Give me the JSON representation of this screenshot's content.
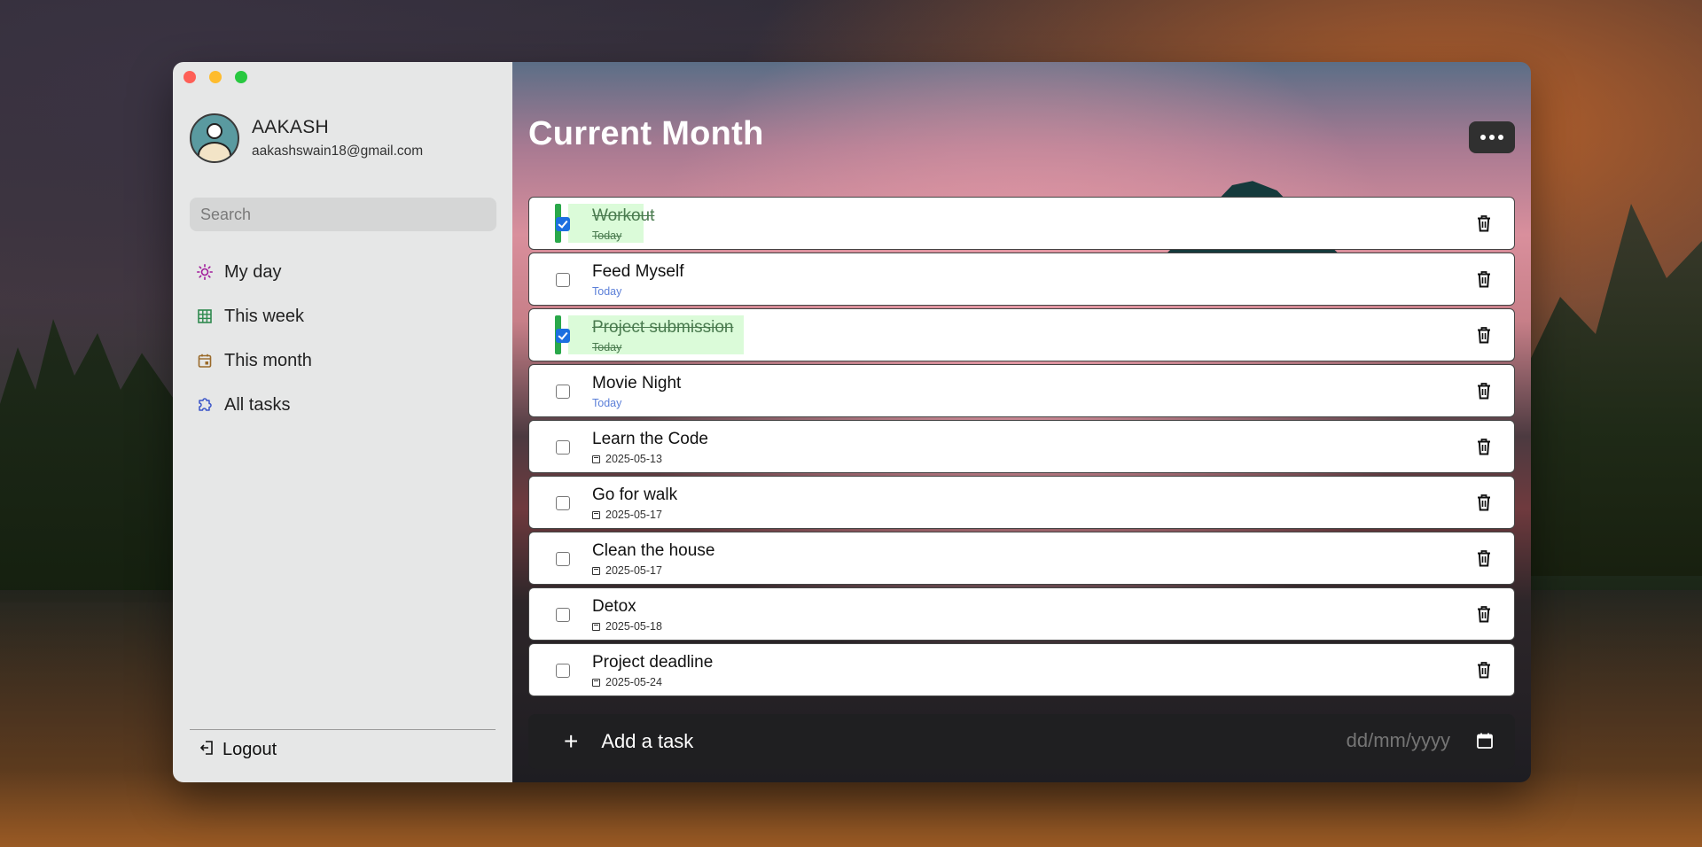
{
  "window": {
    "traffic_lights": [
      "close",
      "minimize",
      "maximize"
    ]
  },
  "sidebar": {
    "profile": {
      "name": "AAKASH",
      "email": "aakashswain18@gmail.com",
      "avatar_icon": "user-avatar-icon"
    },
    "search": {
      "placeholder": "Search",
      "value": ""
    },
    "nav": [
      {
        "label": "My day",
        "icon": "sun-icon",
        "color": "#a11b9a"
      },
      {
        "label": "This week",
        "icon": "grid-icon",
        "color": "#2f8a4f"
      },
      {
        "label": "This month",
        "icon": "calendar-icon",
        "color": "#9a6a2a"
      },
      {
        "label": "All tasks",
        "icon": "puzzle-icon",
        "color": "#3a55c9"
      }
    ],
    "logout_label": "Logout"
  },
  "main": {
    "title": "Current Month",
    "more_icon": "ellipsis-icon",
    "tasks": [
      {
        "title": "Workout",
        "meta": "Today",
        "meta_type": "today",
        "done": true
      },
      {
        "title": "Feed Myself",
        "meta": "Today",
        "meta_type": "today",
        "done": false
      },
      {
        "title": "Project submission",
        "meta": "Today",
        "meta_type": "today",
        "done": true
      },
      {
        "title": "Movie Night",
        "meta": "Today",
        "meta_type": "today",
        "done": false
      },
      {
        "title": "Learn the Code",
        "meta": "2025-05-13",
        "meta_type": "date",
        "done": false
      },
      {
        "title": "Go for walk",
        "meta": "2025-05-17",
        "meta_type": "date",
        "done": false
      },
      {
        "title": "Clean the house",
        "meta": "2025-05-17",
        "meta_type": "date",
        "done": false
      },
      {
        "title": "Detox",
        "meta": "2025-05-18",
        "meta_type": "date",
        "done": false
      },
      {
        "title": "Project deadline",
        "meta": "2025-05-24",
        "meta_type": "date",
        "done": false
      }
    ],
    "add_task": {
      "plus": "+",
      "label": "Add a task",
      "date_placeholder": "dd/mm/yyyy"
    }
  },
  "colors": {
    "done_accent": "#2aa84a",
    "done_highlight": "#dbfbd9",
    "checkbox_checked": "#1b6fe0",
    "today_text": "#5b7fd8"
  }
}
